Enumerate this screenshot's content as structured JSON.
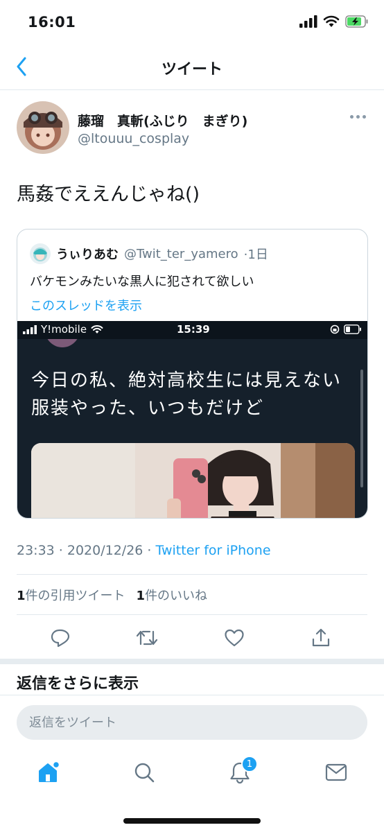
{
  "status_bar": {
    "time": "16:01"
  },
  "nav": {
    "title": "ツイート"
  },
  "tweet": {
    "author_name": "藤瑠　真斬(ふじり　まぎり)",
    "author_handle": "@ltouuu_cosplay",
    "text": "馬姦でええんじゃね()",
    "timestamp": "23:33 · 2020/12/26 · ",
    "source": "Twitter for iPhone"
  },
  "quote": {
    "name": "うぃりあむ",
    "handle": "@Twit_ter_yamero",
    "age": "·1日",
    "text": "バケモンみたいな黒人に犯されて欲しい",
    "show_thread": "このスレッドを表示",
    "screenshot": {
      "carrier": "Y!mobile",
      "time": "15:39",
      "text": "今日の私、絶対高校生には見えない\n服装やった、いつもだけど"
    }
  },
  "stats": {
    "quotes_count": "1",
    "quotes_label": "件の引用ツイート",
    "likes_count": "1",
    "likes_label": "件のいいね"
  },
  "more_replies": "返信をさらに表示",
  "reply": {
    "placeholder": "返信をツイート"
  },
  "tab_bar": {
    "notifications_badge": "1"
  },
  "colors": {
    "accent": "#1da1f2",
    "secondary_text": "#657786",
    "divider": "#e1e8ed"
  }
}
